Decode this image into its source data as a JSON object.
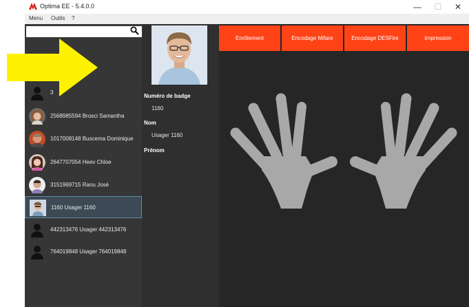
{
  "window": {
    "title": "Optima EE - 5.4.0.0",
    "controls": {
      "minimize": "—",
      "maximize": "☐",
      "close": "✕"
    }
  },
  "menu": {
    "items": [
      "Menu",
      "Outils",
      "?"
    ]
  },
  "search": {
    "value": "",
    "placeholder": ""
  },
  "users": [
    {
      "label": "3",
      "avatar": "silhouette",
      "selected": false
    },
    {
      "label": "2568985594  Brosci  Samantha",
      "avatar": "photo",
      "selected": false
    },
    {
      "label": "1017008148  Buscema  Dominique",
      "avatar": "photo",
      "selected": false
    },
    {
      "label": "2647707054  Heev  Chloe",
      "avatar": "photo",
      "selected": false
    },
    {
      "label": "3151969715  Ranu  José",
      "avatar": "photo",
      "selected": false
    },
    {
      "label": "1160  Usager  1160",
      "avatar": "photo",
      "selected": true
    },
    {
      "label": "442313476  Usager  442313476",
      "avatar": "silhouette",
      "selected": false
    },
    {
      "label": "764019848  Usager  764019848",
      "avatar": "silhouette",
      "selected": false
    }
  ],
  "details": {
    "badge_label": "Numéro de badge",
    "badge_value": "1160",
    "name_label": "Nom",
    "name_value": "Usager  1160",
    "firstname_label": "Prénom",
    "firstname_value": ""
  },
  "tabs": [
    "Enrôlement",
    "Encodage Mifare",
    "Encodage DESFire",
    "Impression"
  ],
  "colors": {
    "tab_active": "#ff4317",
    "background": "#262626",
    "hand": "#a8a8a8",
    "arrow": "#fff200",
    "selection_border": "#5a8ca8"
  }
}
